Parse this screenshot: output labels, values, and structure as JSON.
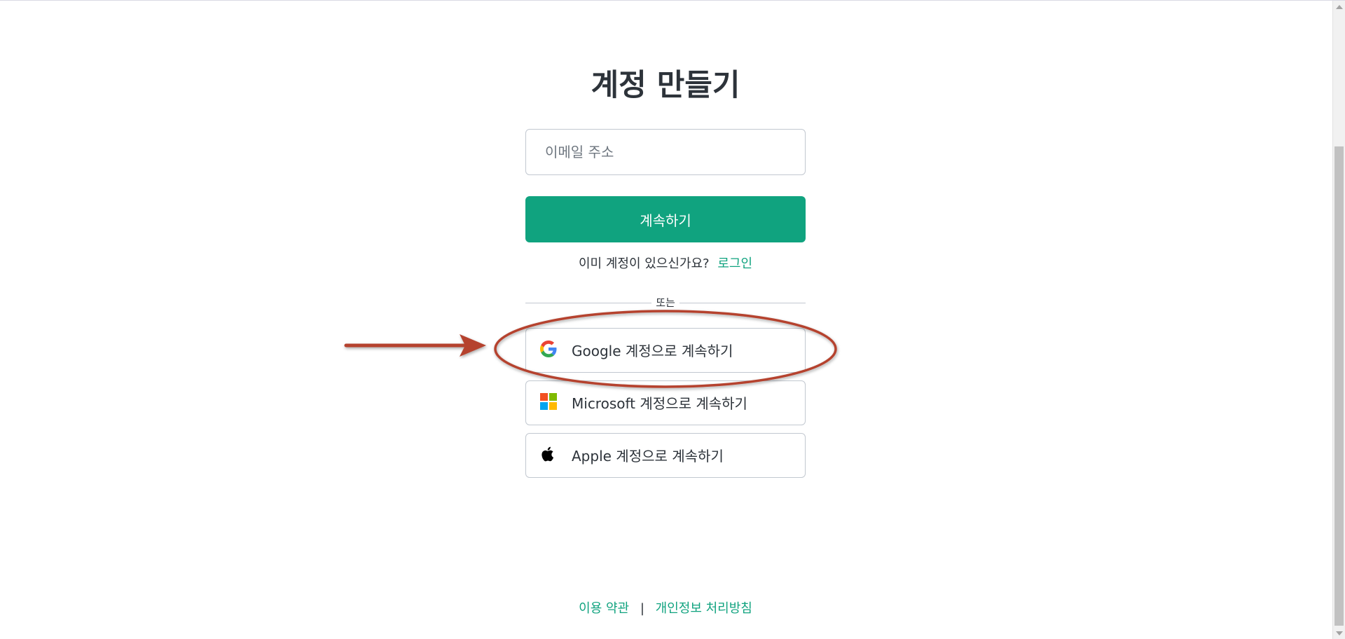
{
  "page": {
    "title": "계정 만들기"
  },
  "form": {
    "email_placeholder": "이메일 주소",
    "continue_label": "계속하기"
  },
  "login": {
    "prompt": "이미 계정이 있으신가요?",
    "link_label": "로그인"
  },
  "divider": {
    "label": "또는"
  },
  "social": [
    {
      "provider": "google",
      "icon": "google-icon",
      "label": "Google 계정으로 계속하기"
    },
    {
      "provider": "microsoft",
      "icon": "microsoft-icon",
      "label": "Microsoft 계정으로 계속하기"
    },
    {
      "provider": "apple",
      "icon": "apple-icon",
      "label": "Apple 계정으로 계속하기"
    }
  ],
  "footer": {
    "terms_label": "이용 약관",
    "separator": "|",
    "privacy_label": "개인정보 처리방침"
  },
  "colors": {
    "accent": "#10a37f",
    "annotation": "#b5432f",
    "text": "#2d333a",
    "border": "#c2c8d0"
  }
}
